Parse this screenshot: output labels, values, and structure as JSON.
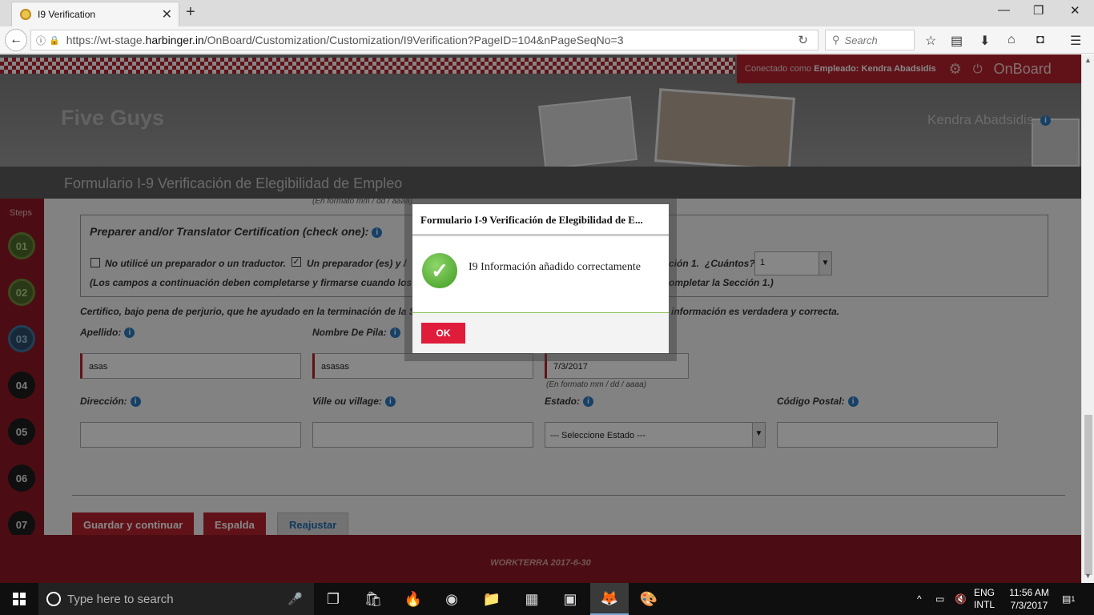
{
  "browser": {
    "tab_title": "I9 Verification",
    "url_prefix": "https://wt-stage.",
    "url_host": "harbinger.in",
    "url_path": "/OnBoard/Customization/Customization/I9Verification?PageID=104&nPageSeqNo=3",
    "search_placeholder": "Search"
  },
  "header": {
    "company": "Five Guys",
    "connected_as": "Conectado como",
    "role": "Empleado:",
    "user_name": "Kendra Abadsidis",
    "brand": "OnBoard",
    "display_name": "Kendra Abadsidis"
  },
  "form": {
    "title": "Formulario I-9 Verificación de Elegibilidad de Empleo",
    "date_hint_top": "(En formato mm / dd / aaaa)",
    "cert_title": "Preparer and/or Translator Certification (check one):",
    "option_no_preparer": "No utilicé un preparador o un traductor.",
    "option_preparer": "Un preparador (es) y /",
    "option_preparer_tail": "ción 1.",
    "how_many_label": "¿Cuántos?",
    "how_many_value": "1",
    "note_left": "(Los campos a continuación deben completarse y firmarse cuando los p",
    "note_right": "ompletar la Sección 1.)",
    "certify_left": "Certifico, bajo pena de perjurio, que he ayudado en la terminación de la S",
    "certify_right": "información es verdadera y correcta.",
    "last_name_label": "Apellido:",
    "last_name_value": "asas",
    "first_name_label": "Nombre De Pila:",
    "first_name_value": "asasas",
    "date_value": "7/3/2017",
    "date_hint": "(En formato mm / dd / aaaa)",
    "address_label": "Dirección:",
    "city_label": "Ville ou village:",
    "state_label": "Estado:",
    "state_value": "--- Seleccione Estado ---",
    "zip_label": "Código Postal:",
    "btn_save": "Guardar y continuar",
    "btn_back": "Espalda",
    "btn_reset": "Reajustar"
  },
  "steps": {
    "label": "Steps",
    "items": [
      "01",
      "02",
      "03",
      "04",
      "05",
      "06",
      "07"
    ]
  },
  "footer": {
    "text": "WORKTERRA 2017-6-30"
  },
  "modal": {
    "title": "Formulario I-9 Verificación de Elegibilidad de E...",
    "message": "I9 Información añadido correctamente",
    "ok_label": "OK"
  },
  "taskbar": {
    "search_placeholder": "Type here to search",
    "lang": "ENG",
    "layout": "INTL",
    "time": "11:56 AM",
    "date": "7/3/2017",
    "notifications": "1"
  },
  "colors": {
    "brand_red": "#b7222f",
    "ok_red": "#e01c3b",
    "success_green": "#3f9a22"
  }
}
